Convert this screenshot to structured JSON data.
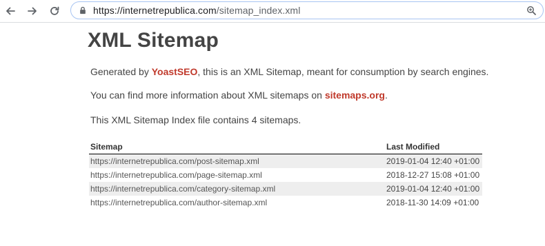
{
  "browser": {
    "url_host": "https://internetrepublica.com",
    "url_path": "/sitemap_index.xml"
  },
  "page": {
    "title": "XML Sitemap",
    "p1_prefix": "Generated by ",
    "p1_link": "YoastSEO",
    "p1_suffix": ", this is an XML Sitemap, meant for consumption by search engines.",
    "p2_prefix": "You can find more information about XML sitemaps on ",
    "p2_link": "sitemaps.org",
    "p2_suffix": ".",
    "p3": "This XML Sitemap Index file contains 4 sitemaps."
  },
  "table": {
    "headers": [
      "Sitemap",
      "Last Modified"
    ],
    "rows": [
      {
        "url": "https://internetrepublica.com/post-sitemap.xml",
        "modified": "2019-01-04 12:40 +01:00"
      },
      {
        "url": "https://internetrepublica.com/page-sitemap.xml",
        "modified": "2018-12-27 15:08 +01:00"
      },
      {
        "url": "https://internetrepublica.com/category-sitemap.xml",
        "modified": "2019-01-04 12:40 +01:00"
      },
      {
        "url": "https://internetrepublica.com/author-sitemap.xml",
        "modified": "2018-11-30 14:09 +01:00"
      }
    ]
  },
  "colors": {
    "link_accent": "#c0392b",
    "row_shade": "#eeeeee",
    "heading_text": "#444444"
  },
  "icons": [
    "back-arrow-icon",
    "forward-arrow-icon",
    "reload-icon",
    "lock-icon",
    "zoom-icon"
  ]
}
